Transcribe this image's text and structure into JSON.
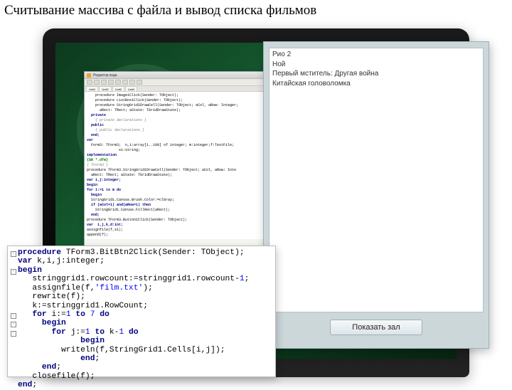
{
  "slide": {
    "title": "Считывание массива с файла и вывод списка\nфильмов"
  },
  "ide": {
    "title": "Редактор кода",
    "tabs": [
      "Unit1",
      "Unit2",
      "Unit3",
      "Unit4"
    ],
    "code_lines": [
      {
        "t": "    procedure Image1Click(Sender: TObject);",
        "cls": ""
      },
      {
        "t": "    procedure ListBox1Click(Sender: TObject);",
        "cls": ""
      },
      {
        "t": "    procedure StringGrid1DrawCell(Sender: TObject; aCol, aRow: Integer;",
        "cls": ""
      },
      {
        "t": "      aRect: TRect; aState: TGridDrawState);",
        "cls": ""
      },
      {
        "t": "  private",
        "cls": "kw"
      },
      {
        "t": "    { private declarations }",
        "cls": "cm"
      },
      {
        "t": "  public",
        "cls": "kw"
      },
      {
        "t": "    { public declarations }",
        "cls": "cm"
      },
      {
        "t": "  end;",
        "cls": "kw"
      },
      {
        "t": "",
        "cls": ""
      },
      {
        "t": "var",
        "cls": "kw"
      },
      {
        "t": "  Form3: TForm3;  n,i:array[1..100] of integer; m:integer;f:TextFile;",
        "cls": ""
      },
      {
        "t": "               s1:string;",
        "cls": ""
      },
      {
        "t": "implementation",
        "cls": "kw"
      },
      {
        "t": "",
        "cls": ""
      },
      {
        "t": "{$R *.dfm}",
        "cls": "dr"
      },
      {
        "t": "",
        "cls": ""
      },
      {
        "t": "{ TForm3 }",
        "cls": "cm"
      },
      {
        "t": "",
        "cls": ""
      },
      {
        "t": "procedure TForm3.StringGrid1DrawCell(Sender: TObject; aCol, aRow: Inte",
        "cls": ""
      },
      {
        "t": "  aRect: TRect; aState: TGridDrawState);",
        "cls": ""
      },
      {
        "t": "var i,j:integer;",
        "cls": "kw"
      },
      {
        "t": "begin",
        "cls": "kw"
      },
      {
        "t": "",
        "cls": ""
      },
      {
        "t": "for i:=1 to m do",
        "cls": "kw"
      },
      {
        "t": "  begin",
        "cls": "kw"
      },
      {
        "t": "  StringGrid1.Canvas.Brush.Color:=clGray;",
        "cls": ""
      },
      {
        "t": "  if (aCol=i) and(aRow=i) then",
        "cls": "kw"
      },
      {
        "t": "    StringGrid1.Canvas.FillRect(aRect);",
        "cls": ""
      },
      {
        "t": "  end;",
        "cls": "kw"
      },
      {
        "t": "",
        "cls": ""
      },
      {
        "t": "procedure TForm3.Button1Click(Sender: TObject);",
        "cls": ""
      },
      {
        "t": "var  i,j,k,d:int;",
        "cls": "kw"
      },
      {
        "t": "",
        "cls": ""
      },
      {
        "t": "assignfile(f,s1);",
        "cls": ""
      },
      {
        "t": "append(f);",
        "cls": ""
      }
    ]
  },
  "app": {
    "films": [
      "Рио 2",
      "Ной",
      "Первый мститель: Другая война",
      "Китайская головоломка"
    ],
    "button_label": "Показать зал"
  },
  "code_snippet": {
    "folds": [
      "⊟",
      "",
      "⊟",
      "",
      "",
      "",
      "",
      "⊟",
      "⊟",
      "⊟",
      "",
      "",
      "",
      "",
      ""
    ],
    "lines": [
      {
        "segments": [
          {
            "t": "procedure ",
            "c": "kw"
          },
          {
            "t": "TForm3.BitBtn2Click(Sender: TObject);",
            "c": "id"
          }
        ]
      },
      {
        "segments": [
          {
            "t": "var ",
            "c": "kw"
          },
          {
            "t": "k,i,j:integer;",
            "c": "id"
          }
        ]
      },
      {
        "segments": [
          {
            "t": "begin",
            "c": "kw"
          }
        ]
      },
      {
        "segments": [
          {
            "t": "   stringgrid1.rowcount:=stringgrid1.rowcount-",
            "c": "id"
          },
          {
            "t": "1",
            "c": "num"
          },
          {
            "t": ";",
            "c": "id"
          }
        ]
      },
      {
        "segments": [
          {
            "t": "   assignfile(f,",
            "c": "id"
          },
          {
            "t": "'film.txt'",
            "c": "str"
          },
          {
            "t": ");",
            "c": "id"
          }
        ]
      },
      {
        "segments": [
          {
            "t": "   rewrite(f);",
            "c": "id"
          }
        ]
      },
      {
        "segments": [
          {
            "t": "   k:=stringgrid1.RowCount;",
            "c": "id"
          }
        ]
      },
      {
        "segments": [
          {
            "t": "   for ",
            "c": "kw"
          },
          {
            "t": "i:=",
            "c": "id"
          },
          {
            "t": "1",
            "c": "num"
          },
          {
            "t": " to ",
            "c": "kw"
          },
          {
            "t": "7",
            "c": "num"
          },
          {
            "t": " do",
            "c": "kw"
          }
        ]
      },
      {
        "segments": [
          {
            "t": "     begin",
            "c": "kw"
          }
        ]
      },
      {
        "segments": [
          {
            "t": "       for ",
            "c": "kw"
          },
          {
            "t": "j:=",
            "c": "id"
          },
          {
            "t": "1",
            "c": "num"
          },
          {
            "t": " to ",
            "c": "kw"
          },
          {
            "t": "k-",
            "c": "id"
          },
          {
            "t": "1",
            "c": "num"
          },
          {
            "t": " do",
            "c": "kw"
          }
        ]
      },
      {
        "segments": [
          {
            "t": "             begin",
            "c": "kw"
          }
        ]
      },
      {
        "segments": [
          {
            "t": "         writeln(f,StringGrid1.Cells[i,j]);",
            "c": "id"
          }
        ]
      },
      {
        "segments": [
          {
            "t": "             end",
            "c": "kw"
          },
          {
            "t": ";",
            "c": "id"
          }
        ]
      },
      {
        "segments": [
          {
            "t": "     end",
            "c": "kw"
          },
          {
            "t": ";",
            "c": "id"
          }
        ]
      },
      {
        "segments": [
          {
            "t": "   closefile(f);",
            "c": "id"
          }
        ]
      },
      {
        "segments": [
          {
            "t": "end",
            "c": "kw"
          },
          {
            "t": ";",
            "c": "id"
          }
        ]
      }
    ]
  }
}
